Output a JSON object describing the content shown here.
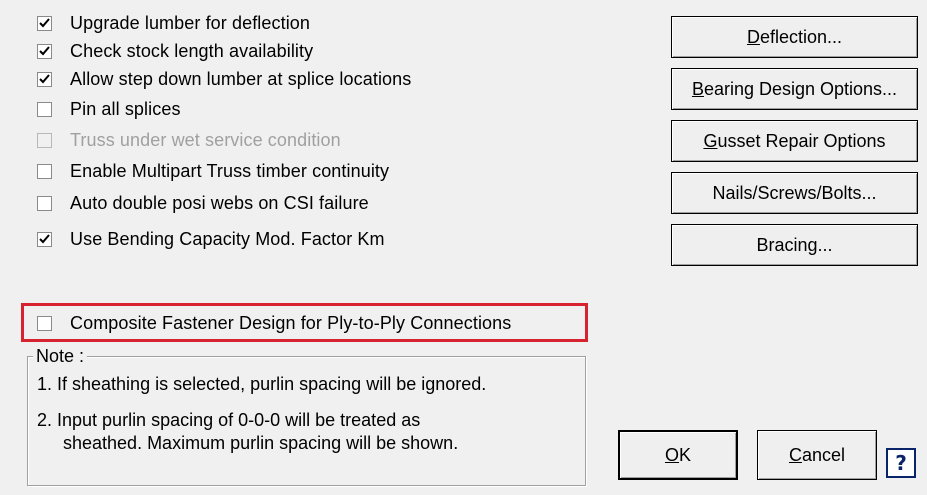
{
  "options": [
    {
      "label": "Upgrade lumber for deflection",
      "checked": true,
      "enabled": true
    },
    {
      "label": "Check stock length availability",
      "checked": true,
      "enabled": true
    },
    {
      "label": "Allow step down lumber at splice locations",
      "checked": true,
      "enabled": true
    },
    {
      "label": "Pin all splices",
      "checked": false,
      "enabled": true
    },
    {
      "label": "Truss under wet service condition",
      "checked": false,
      "enabled": false
    },
    {
      "label": "Enable Multipart Truss timber continuity",
      "checked": false,
      "enabled": true
    },
    {
      "label": "Auto double posi webs on CSI failure",
      "checked": false,
      "enabled": true
    },
    {
      "label": "Use Bending Capacity Mod. Factor Km",
      "checked": true,
      "enabled": true
    }
  ],
  "composite": {
    "label": "Composite Fastener Design for Ply-to-Ply Connections",
    "checked": false
  },
  "note": {
    "title": "Note :",
    "line1": "1. If sheathing is selected, purlin spacing will be ignored.",
    "line2a": "2. Input purlin spacing of 0-0-0 will be treated as",
    "line2b": "sheathed.  Maximum purlin spacing will be shown."
  },
  "buttons": {
    "deflection": {
      "mnemonic": "D",
      "rest": "eflection..."
    },
    "bearing": {
      "mnemonic": "B",
      "rest": "earing Design Options..."
    },
    "gusset": {
      "mnemonic": "G",
      "rest": "usset Repair Options"
    },
    "nails": {
      "label": "Nails/Screws/Bolts..."
    },
    "bracing": {
      "label": "Bracing..."
    },
    "ok": {
      "mnemonic": "O",
      "rest": "K"
    },
    "cancel": {
      "mnemonic": "C",
      "rest": "ancel"
    }
  },
  "help": {
    "glyph": "?",
    "icon": "help-icon"
  },
  "colors": {
    "highlight": "#d6232f",
    "help": "#0a246a"
  }
}
